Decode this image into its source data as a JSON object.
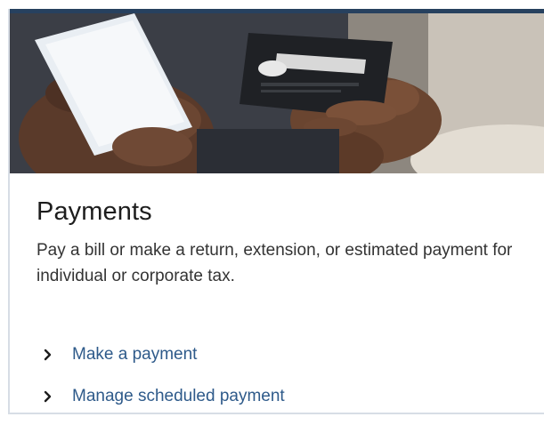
{
  "card": {
    "title": "Payments",
    "description": "Pay a bill or make a return, extension, or estimated payment for individual or corporate tax.",
    "hero_image": "hands-holding-phone-and-credit-card",
    "accent_color": "#27415f",
    "link_color": "#2e5a8a",
    "links": [
      {
        "label": "Make a payment",
        "icon": "chevron-right-icon"
      },
      {
        "label": "Manage scheduled payment",
        "icon": "chevron-right-icon"
      }
    ]
  }
}
